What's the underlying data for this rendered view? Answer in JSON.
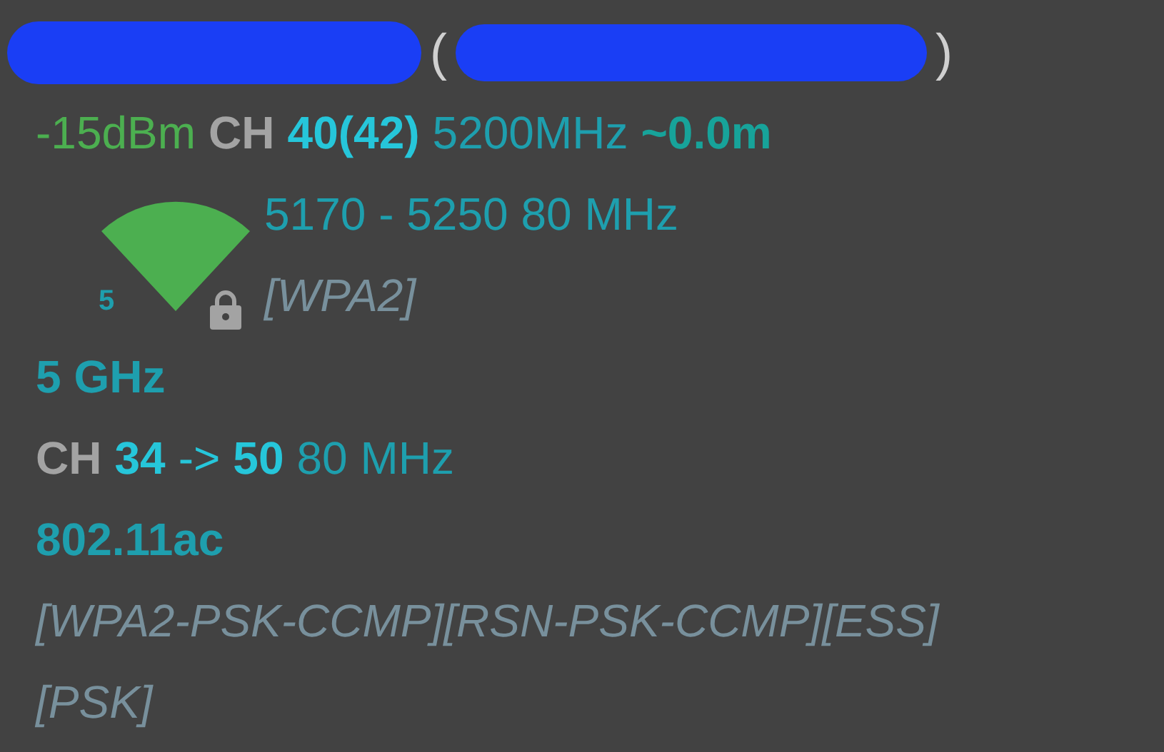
{
  "header": {
    "open_paren": "(",
    "close_paren": ")"
  },
  "signal": {
    "power": "-15dBm",
    "ch_label": "CH",
    "channel": "40(42)",
    "frequency": "5200MHz",
    "distance": "~0.0m"
  },
  "icon": {
    "level_label": "5",
    "locked": true
  },
  "range": "5170 - 5250 80 MHz",
  "security_short": "[WPA2]",
  "band": "5 GHz",
  "channel_span": {
    "ch_label": "CH",
    "from": "34",
    "arrow": "->",
    "to": "50",
    "width": "80 MHz"
  },
  "standard": "802.11ac",
  "capabilities": [
    "[WPA2-PSK-CCMP][RSN-PSK-CCMP][ESS]",
    "[PSK]"
  ]
}
